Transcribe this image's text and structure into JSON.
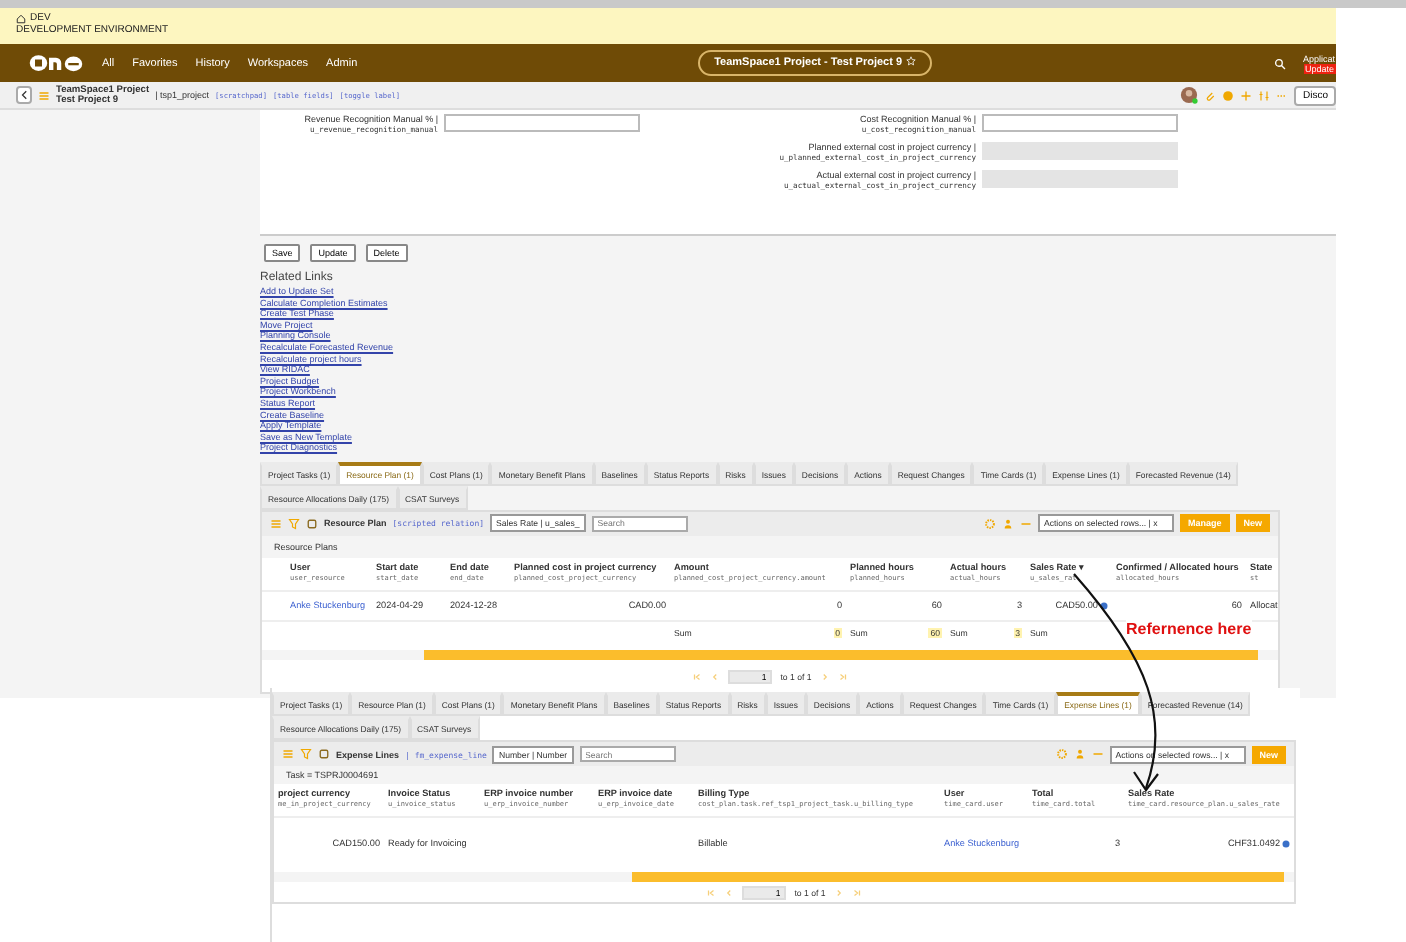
{
  "env_banner": {
    "name": "DEV",
    "description": "DEVELOPMENT ENVIRONMENT"
  },
  "nav": {
    "items": [
      "All",
      "Favorites",
      "History",
      "Workspaces",
      "Admin"
    ],
    "context_title": "TeamSpace1 Project - Test Project 9",
    "alert": {
      "title": "Applicat",
      "action": "Update"
    }
  },
  "header": {
    "record_type": "TeamSpace1 Project",
    "record_name": "Test Project 9",
    "table": "| tsp1_project",
    "links": [
      "[scratchpad]",
      "[table fields]",
      "[toggle label]"
    ],
    "button": "Disco"
  },
  "form": {
    "left_fields": [
      {
        "label": "Revenue Recognition Manual % |",
        "name": "u_revenue_recognition_manual",
        "readonly": false
      }
    ],
    "right_fields": [
      {
        "label": "Cost Recognition Manual % |",
        "name": "u_cost_recognition_manual",
        "readonly": false
      },
      {
        "label": "Planned external cost in project currency |",
        "name": "u_planned_external_cost_in_project_currency",
        "readonly": true
      },
      {
        "label": "Actual external cost in project currency |",
        "name": "u_actual_external_cost_in_project_currency",
        "readonly": true
      }
    ]
  },
  "form_buttons": [
    "Save",
    "Update",
    "Delete"
  ],
  "related_links": {
    "title": "Related Links",
    "links": [
      "Add to Update Set",
      "Calculate Completion Estimates",
      "Create Test Phase",
      "Move Project",
      "Planning Console",
      "Recalculate Forecasted Revenue",
      "Recalculate project hours",
      "View RIDAC",
      "Project Budget",
      "Project Workbench",
      "Status Report",
      "Create Baseline",
      "Apply Template",
      "Save as New Template",
      "Project Diagnostics"
    ]
  },
  "resource_panel": {
    "tabs": [
      {
        "label": "Project Tasks (1)",
        "selected": false
      },
      {
        "label": "Resource Plan (1)",
        "selected": true
      },
      {
        "label": "Cost Plans (1)",
        "selected": false
      },
      {
        "label": "Monetary Benefit Plans",
        "selected": false
      },
      {
        "label": "Baselines",
        "selected": false
      },
      {
        "label": "Status Reports",
        "selected": false
      },
      {
        "label": "Risks",
        "selected": false
      },
      {
        "label": "Issues",
        "selected": false
      },
      {
        "label": "Decisions",
        "selected": false
      },
      {
        "label": "Actions",
        "selected": false
      },
      {
        "label": "Request Changes",
        "selected": false
      },
      {
        "label": "Time Cards (1)",
        "selected": false
      },
      {
        "label": "Expense Lines (1)",
        "selected": false
      },
      {
        "label": "Forecasted Revenue (14)",
        "selected": false
      },
      {
        "label": "Resource Allocations Daily (175)",
        "selected": false
      },
      {
        "label": "CSAT Surveys",
        "selected": false
      }
    ],
    "toolbar": {
      "title": "Resource Plan",
      "relation": "[scripted relation]",
      "filter_field": "Sales Rate | u_sales_",
      "search_placeholder": "Search",
      "actions": "Actions on selected rows... | x",
      "buttons": [
        "Manage",
        "New"
      ]
    },
    "caption": "Resource Plans",
    "columns": [
      {
        "label": "User",
        "field": "user_resource",
        "kind": "link"
      },
      {
        "label": "Start date",
        "field": "start_date",
        "kind": "text"
      },
      {
        "label": "End date",
        "field": "end_date",
        "kind": "text"
      },
      {
        "label": "Planned cost in project currency",
        "field": "planned_cost_project_currency",
        "kind": "number"
      },
      {
        "label": "Amount",
        "field": "planned_cost_project_currency.amount",
        "kind": "number",
        "sum": {
          "label": "Sum",
          "value": "0"
        }
      },
      {
        "label": "Planned hours",
        "field": "planned_hours",
        "kind": "number",
        "sum": {
          "label": "Sum",
          "value": "60"
        }
      },
      {
        "label": "Actual hours",
        "field": "actual_hours",
        "kind": "number",
        "sum": {
          "label": "Sum",
          "value": "3"
        }
      },
      {
        "label": "Sales Rate ▾",
        "field": "u_sales_rat",
        "kind": "number",
        "sum": {
          "label": "Sum"
        }
      },
      {
        "label": "Confirmed / Allocated hours",
        "field": "allocated_hours",
        "kind": "number"
      },
      {
        "label": "State",
        "field": "st",
        "kind": "text"
      }
    ],
    "rows": [
      [
        "Anke Stuckenburg",
        "2024-04-29",
        "2024-12-28",
        "CAD0.00",
        "0",
        "60",
        "3",
        "CAD50.00",
        "60",
        "Allocat"
      ]
    ],
    "pagination": {
      "page": "1",
      "range": "to 1 of 1"
    }
  },
  "expense_panel": {
    "tabs": [
      {
        "label": "Project Tasks (1)",
        "selected": false
      },
      {
        "label": "Resource Plan (1)",
        "selected": false
      },
      {
        "label": "Cost Plans (1)",
        "selected": false
      },
      {
        "label": "Monetary Benefit Plans",
        "selected": false
      },
      {
        "label": "Baselines",
        "selected": false
      },
      {
        "label": "Status Reports",
        "selected": false
      },
      {
        "label": "Risks",
        "selected": false
      },
      {
        "label": "Issues",
        "selected": false
      },
      {
        "label": "Decisions",
        "selected": false
      },
      {
        "label": "Actions",
        "selected": false
      },
      {
        "label": "Request Changes",
        "selected": false
      },
      {
        "label": "Time Cards (1)",
        "selected": false
      },
      {
        "label": "Expense Lines (1)",
        "selected": true
      },
      {
        "label": "Forecasted Revenue (14)",
        "selected": false
      },
      {
        "label": "Resource Allocations Daily (175)",
        "selected": false
      },
      {
        "label": "CSAT Surveys",
        "selected": false
      }
    ],
    "toolbar": {
      "title": "Expense Lines",
      "relation": "| fm_expense_line",
      "filter_field": "Number | Number",
      "search_placeholder": "Search",
      "actions": "Actions on selected rows... | x",
      "buttons": [
        "New"
      ]
    },
    "caption": "Task = TSPRJ0004691",
    "columns": [
      {
        "label": "project currency",
        "field": "me_in_project_currency",
        "kind": "number"
      },
      {
        "label": "Invoice Status",
        "field": "u_invoice_status",
        "kind": "text"
      },
      {
        "label": "ERP invoice number",
        "field": "u_erp_invoice_number",
        "kind": "text"
      },
      {
        "label": "ERP invoice date",
        "field": "u_erp_invoice_date",
        "kind": "text"
      },
      {
        "label": "Billing Type",
        "field": "cost_plan.task.ref_tsp1_project_task.u_billing_type",
        "kind": "text"
      },
      {
        "label": "User",
        "field": "time_card.user",
        "kind": "link"
      },
      {
        "label": "Total",
        "field": "time_card.total",
        "kind": "number"
      },
      {
        "label": "Sales Rate",
        "field": "time_card.resource_plan.u_sales_rate",
        "kind": "number"
      }
    ],
    "rows": [
      [
        "CAD150.00",
        "Ready for Invoicing",
        null,
        null,
        "Billable",
        "Anke Stuckenburg",
        "3",
        "CHF31.0492"
      ]
    ],
    "pagination": {
      "page": "1",
      "range": "to 1 of 1"
    }
  },
  "annotation": {
    "text": "Refernence here"
  }
}
